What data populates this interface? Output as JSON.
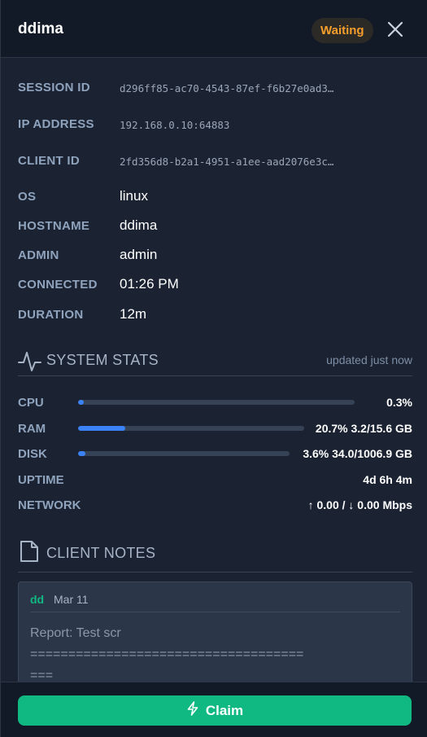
{
  "header": {
    "title": "ddima",
    "status_badge": "Waiting",
    "close_icon": "close-icon"
  },
  "info": [
    {
      "label": "SESSION ID",
      "value": "d296ff85-ac70-4543-87ef-f6b27e0ad3…",
      "mono": true
    },
    {
      "label": "IP ADDRESS",
      "value": "192.168.0.10:64883",
      "mono": true
    },
    {
      "label": "CLIENT ID",
      "value": "2fd356d8-b2a1-4951-a1ee-aad2076e3c…",
      "mono": true
    },
    {
      "label": "OS",
      "value": "linux",
      "mono": false
    },
    {
      "label": "HOSTNAME",
      "value": "ddima",
      "mono": false
    },
    {
      "label": "ADMIN",
      "value": "admin",
      "mono": false
    },
    {
      "label": "CONNECTED",
      "value": "01:26 PM",
      "mono": false
    },
    {
      "label": "DURATION",
      "value": "12m",
      "mono": false
    }
  ],
  "system_stats": {
    "title": "SYSTEM STATS",
    "icon": "activity-icon",
    "updated": "updated just now",
    "cpu": {
      "label": "CPU",
      "value": "0.3%",
      "percent": 0.3
    },
    "ram": {
      "label": "RAM",
      "value": "20.7% 3.2/15.6 GB",
      "percent": 20.7
    },
    "disk": {
      "label": "DISK",
      "value": "3.6% 34.0/1006.9 GB",
      "percent": 3.6
    },
    "uptime": {
      "label": "UPTIME",
      "value": "4d 6h 4m"
    },
    "network": {
      "label": "NETWORK",
      "value": "↑ 0.00 / ↓ 0.00 Mbps"
    },
    "bar_color": "#3b82f6"
  },
  "client_notes": {
    "title": "CLIENT NOTES",
    "icon": "file-icon",
    "notes": [
      {
        "author": "dd",
        "date": "Mar 11",
        "text": "Report: Test scr\n=====================================",
        "text_line1": "Report: Test scr",
        "text_line2": "====================================",
        "text_line3": "==="
      }
    ]
  },
  "footer": {
    "claim_label": "Claim",
    "claim_icon": "lightning-icon",
    "accent": "#10b981"
  }
}
